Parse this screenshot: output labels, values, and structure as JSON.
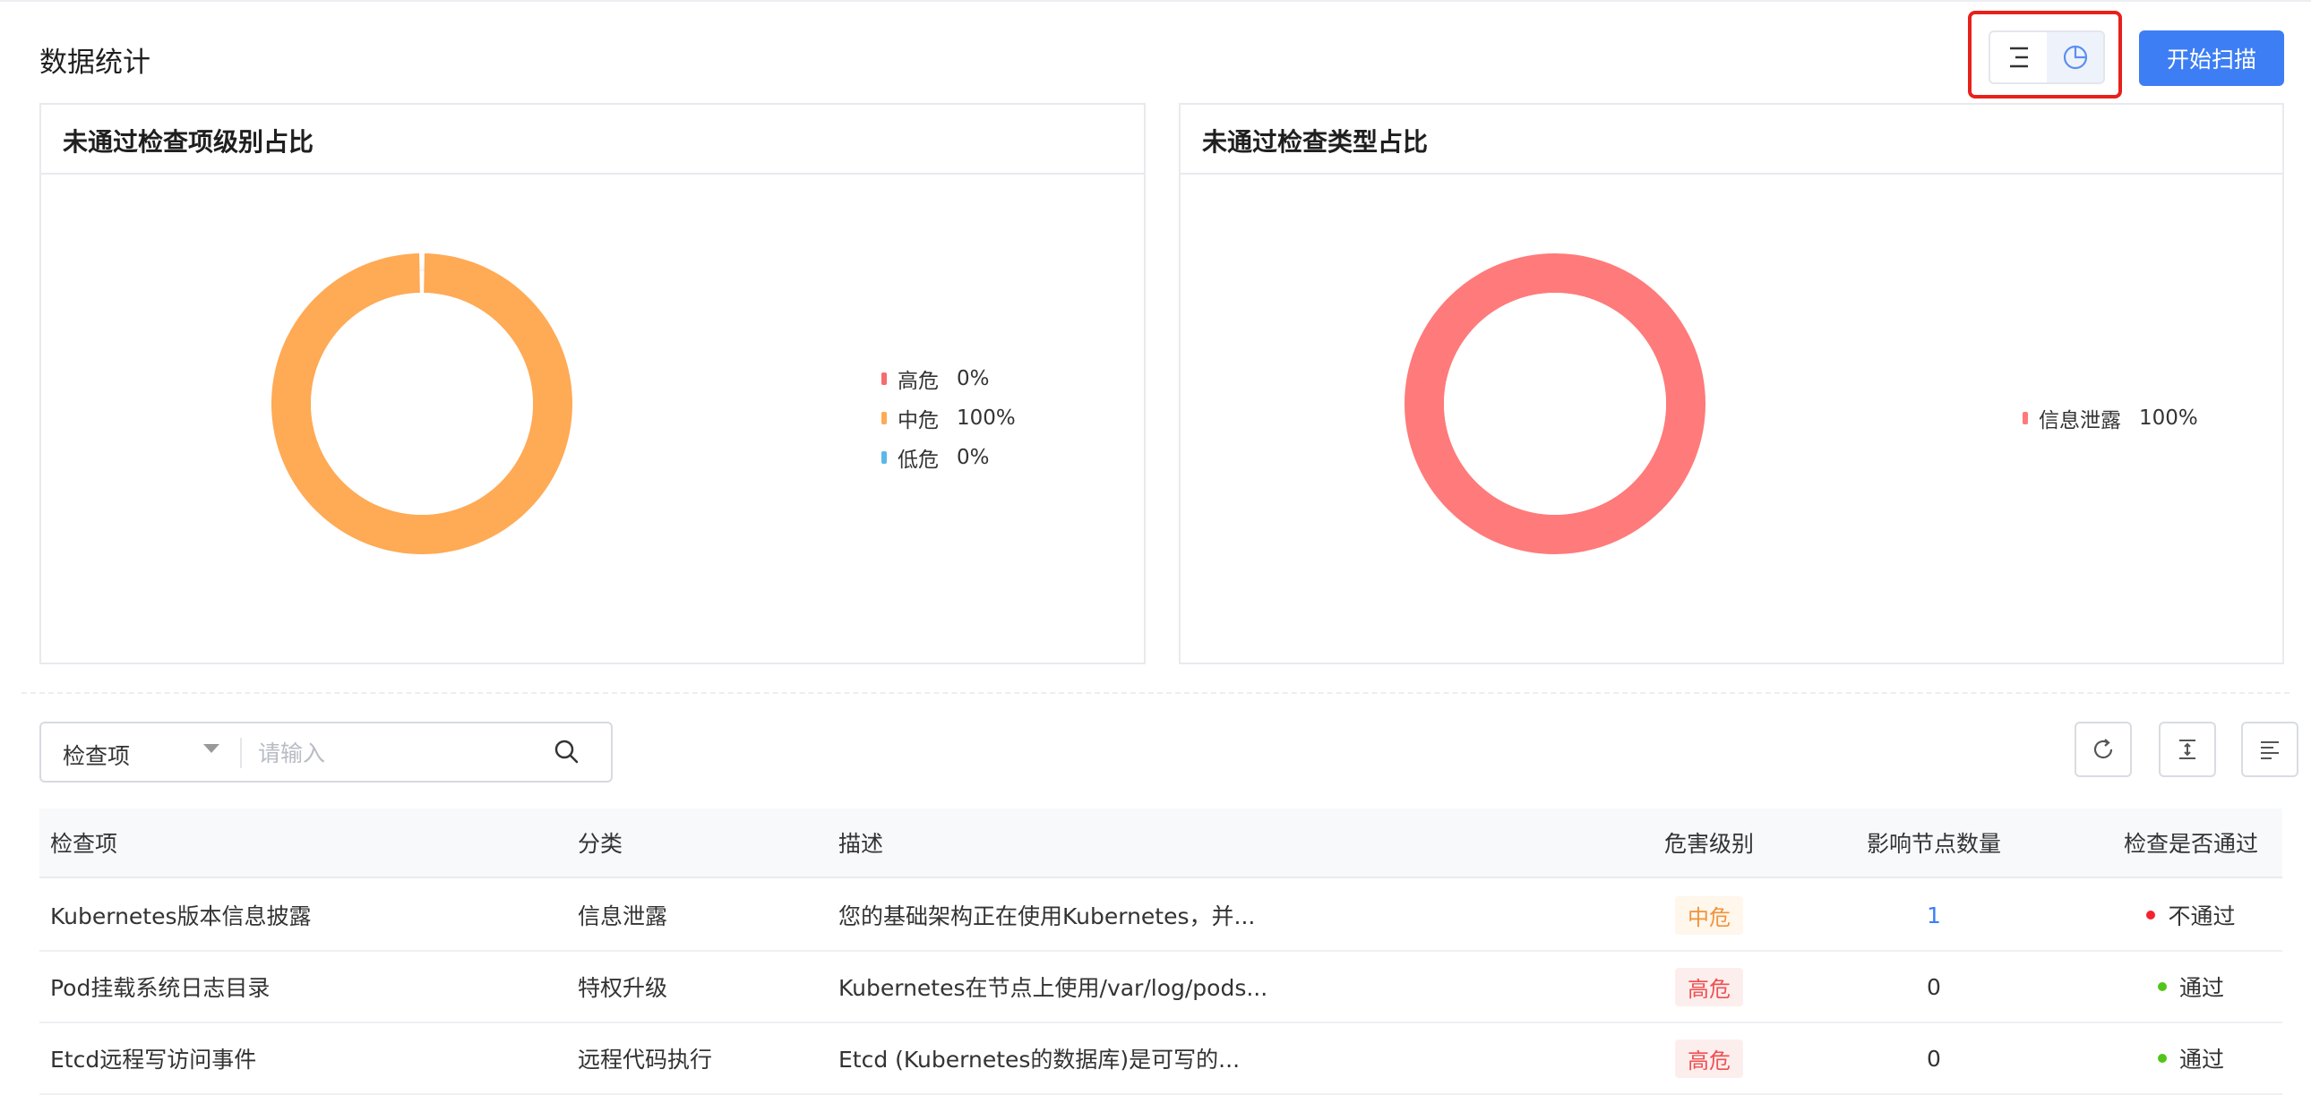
{
  "header": {
    "title": "数据统计",
    "scan_button": "开始扫描"
  },
  "charts": {
    "level_title": "未通过检查项级别占比",
    "type_title": "未通过检查类型占比"
  },
  "chart_data": [
    {
      "type": "pie",
      "title": "未通过检查项级别占比",
      "categories": [
        "高危",
        "中危",
        "低危"
      ],
      "values": [
        0,
        100,
        0
      ],
      "labels": [
        "0%",
        "100%",
        "0%"
      ],
      "colors": [
        "#f56c6c",
        "#ffaa55",
        "#5bb8e8"
      ],
      "legend": "right"
    },
    {
      "type": "pie",
      "title": "未通过检查类型占比",
      "categories": [
        "信息泄露"
      ],
      "values": [
        100
      ],
      "labels": [
        "100%"
      ],
      "colors": [
        "#ff7a7a"
      ],
      "legend": "right"
    }
  ],
  "search": {
    "field": "检查项",
    "placeholder": "请输入"
  },
  "table": {
    "headers": [
      "检查项",
      "分类",
      "描述",
      "危害级别",
      "影响节点数量",
      "检查是否通过"
    ],
    "rows": [
      {
        "item": "Kubernetes版本信息披露",
        "category": "信息泄露",
        "desc": "您的基础架构正在使用Kubernetes，并...",
        "level": "中危",
        "nodes": "1",
        "status": "不通过"
      },
      {
        "item": "Pod挂载系统日志目录",
        "category": "特权升级",
        "desc": "Kubernetes在节点上使用/var/log/pods...",
        "level": "高危",
        "nodes": "0",
        "status": "通过"
      },
      {
        "item": "Etcd远程写访问事件",
        "category": "远程代码执行",
        "desc": "Etcd (Kubernetes的数据库)是可写的...",
        "level": "高危",
        "nodes": "0",
        "status": "通过"
      }
    ]
  },
  "colors": {
    "primary": "#3d7ef5",
    "medium_text": "#f0943a",
    "medium_bg": "#fff6ec",
    "high_text": "#f05050",
    "high_bg": "#fdeeee",
    "fail_dot": "#f5222d",
    "pass_dot": "#52c41a",
    "link": "#3d7ef5"
  }
}
